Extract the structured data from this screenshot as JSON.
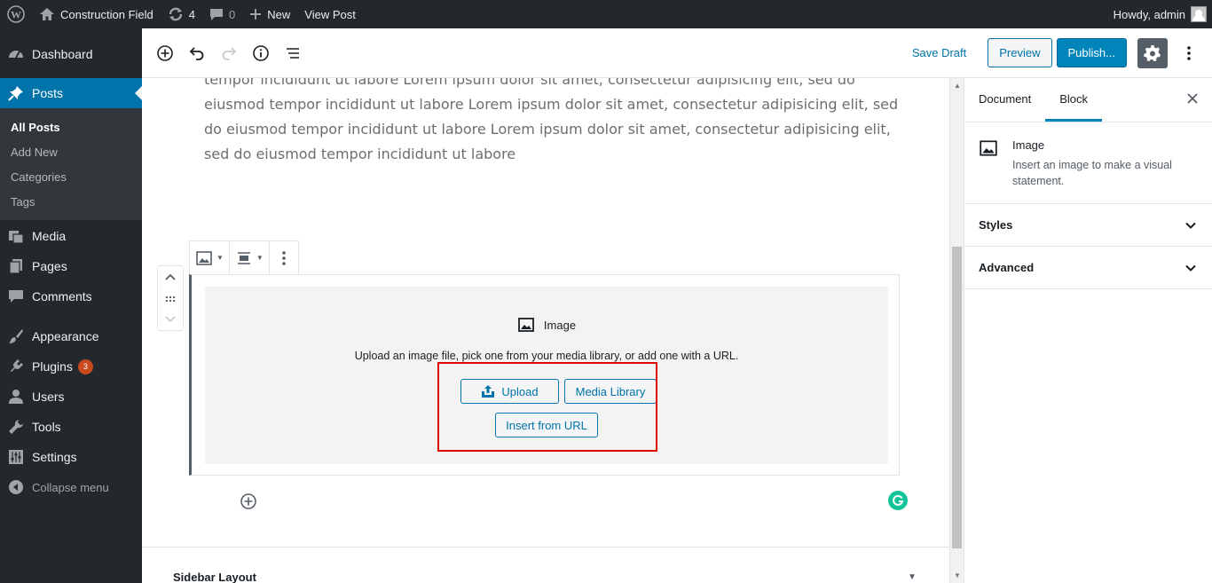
{
  "adminbar": {
    "site_name": "Construction Field",
    "updates_count": "4",
    "comments_count": "0",
    "new_label": "New",
    "view_post_label": "View Post",
    "howdy": "Howdy, admin"
  },
  "menu": {
    "dashboard": "Dashboard",
    "posts": "Posts",
    "posts_sub": [
      "All Posts",
      "Add New",
      "Categories",
      "Tags"
    ],
    "media": "Media",
    "pages": "Pages",
    "comments": "Comments",
    "appearance": "Appearance",
    "plugins": "Plugins",
    "plugins_badge": "3",
    "users": "Users",
    "tools": "Tools",
    "settings": "Settings",
    "collapse": "Collapse menu"
  },
  "toolbar": {
    "save_draft": "Save Draft",
    "preview": "Preview",
    "publish": "Publish..."
  },
  "content": {
    "paragraph": "tempor incididunt ut labore Lorem ipsum dolor sit amet, consectetur adipisicing elit, sed do eiusmod tempor incididunt ut labore Lorem ipsum dolor sit amet, consectetur adipisicing elit, sed do eiusmod tempor incididunt ut labore Lorem ipsum dolor sit amet, consectetur adipisicing elit, sed do eiusmod tempor incididunt ut labore",
    "image_block": {
      "title": "Image",
      "instructions": "Upload an image file, pick one from your media library, or add one with a URL.",
      "upload": "Upload",
      "media_library": "Media Library",
      "insert_url": "Insert from URL"
    },
    "meta_box": "Sidebar Layout"
  },
  "settings": {
    "tab_document": "Document",
    "tab_block": "Block",
    "block_name": "Image",
    "block_desc": "Insert an image to make a visual statement.",
    "panels": [
      "Styles",
      "Advanced"
    ]
  },
  "colors": {
    "admin_dark": "#23282d",
    "wp_blue": "#0073aa",
    "highlight_red": "#e00000"
  }
}
